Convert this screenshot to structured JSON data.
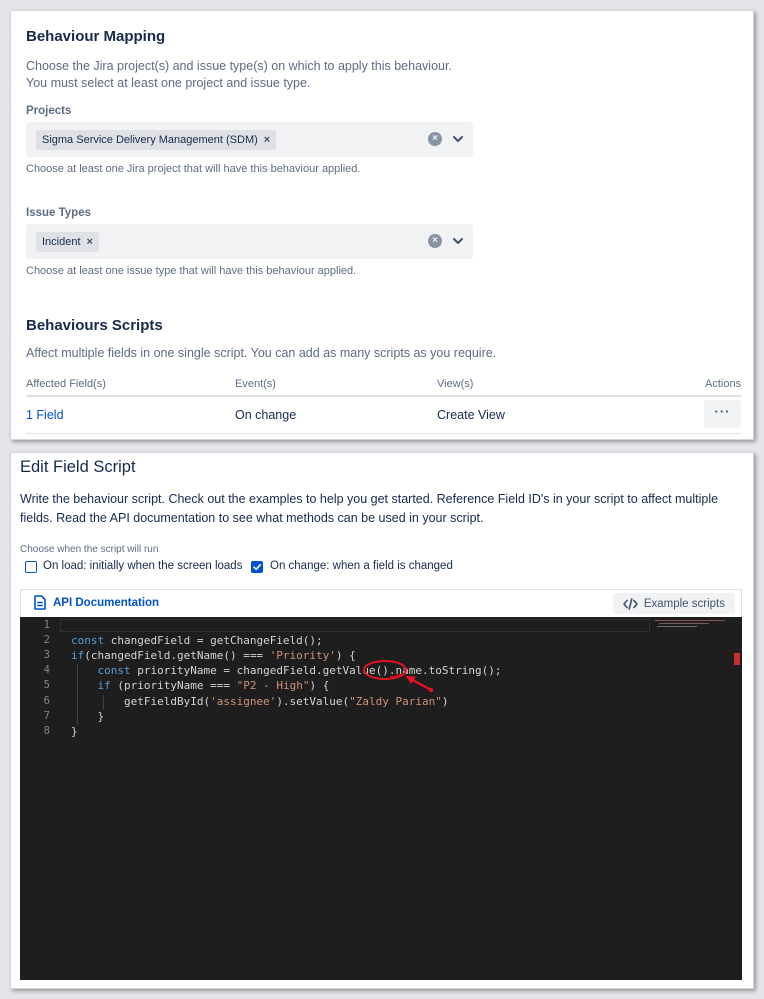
{
  "behaviour_mapping": {
    "title": "Behaviour Mapping",
    "intro_line1": "Choose the Jira project(s) and issue type(s) on which to apply this behaviour.",
    "intro_line2": "You must select at least one project and issue type.",
    "projects": {
      "label": "Projects",
      "selected": "Sigma Service Delivery Management (SDM)",
      "helper": "Choose at least one Jira project that will have this behaviour applied."
    },
    "issue_types": {
      "label": "Issue Types",
      "selected": "Incident",
      "helper": "Choose at least one issue type that will have this behaviour applied."
    },
    "remove_glyph": "×"
  },
  "behaviours_scripts": {
    "title": "Behaviours Scripts",
    "description": "Affect multiple fields in one single script. You can add as many scripts as you require.",
    "columns": [
      "Affected Field(s)",
      "Event(s)",
      "View(s)",
      "Actions"
    ],
    "rows": [
      {
        "fields": "1 Field",
        "event": "On change",
        "view": "Create View",
        "actions": "···"
      }
    ]
  },
  "edit_field_script": {
    "title": "Edit Field Script",
    "description": "Write the behaviour script. Check out the examples to help you get started. Reference Field ID's in your script to affect multiple fields. Read the API documentation to see what methods can be used in your script.",
    "run_label": "Choose when the script will run",
    "on_load": {
      "label": "On load: initially when the screen loads",
      "checked": false
    },
    "on_change": {
      "label": "On change: when a field is changed",
      "checked": true
    },
    "api_doc_label": "API Documentation",
    "example_scripts_label": "Example scripts"
  },
  "code": {
    "line_numbers": [
      "1",
      "2",
      "3",
      "4",
      "5",
      "6",
      "7",
      "8"
    ],
    "lines": [
      [],
      [
        {
          "t": "kw",
          "v": "const"
        },
        {
          "t": "tx",
          "v": " changedField = getChangeField();"
        }
      ],
      [
        {
          "t": "kw",
          "v": "if"
        },
        {
          "t": "tx",
          "v": "(changedField.getName() === "
        },
        {
          "t": "str",
          "v": "'Priority'"
        },
        {
          "t": "tx",
          "v": ") {"
        }
      ],
      [
        {
          "t": "tx",
          "v": "    "
        },
        {
          "t": "kw",
          "v": "const"
        },
        {
          "t": "tx",
          "v": " priorityName = changedField.getValue().name.toString();"
        }
      ],
      [
        {
          "t": "tx",
          "v": "    "
        },
        {
          "t": "kw",
          "v": "if"
        },
        {
          "t": "tx",
          "v": " (priorityName === "
        },
        {
          "t": "str",
          "v": "\"P2 - High\""
        },
        {
          "t": "tx",
          "v": ") {"
        }
      ],
      [
        {
          "t": "tx",
          "v": "        getFieldById("
        },
        {
          "t": "str",
          "v": "'assignee'"
        },
        {
          "t": "tx",
          "v": ").setValue("
        },
        {
          "t": "str",
          "v": "\"Zaldy Parian\""
        },
        {
          "t": "tx",
          "v": ")"
        }
      ],
      [
        {
          "t": "tx",
          "v": "    }"
        }
      ],
      [
        {
          "t": "tx",
          "v": "}"
        }
      ]
    ]
  },
  "colors": {
    "accent": "#0052cc",
    "editor_bg": "#1e1e1e",
    "annotation": "#e81123"
  }
}
